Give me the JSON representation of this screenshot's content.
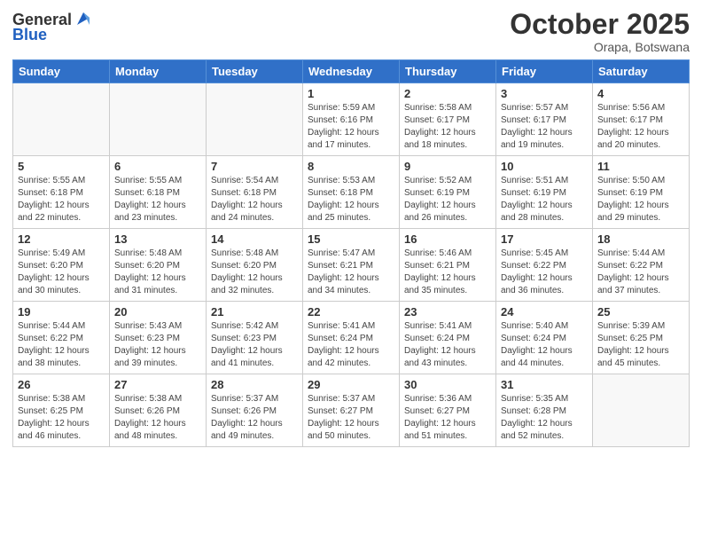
{
  "header": {
    "logo_general": "General",
    "logo_blue": "Blue",
    "month_title": "October 2025",
    "location": "Orapa, Botswana"
  },
  "days_of_week": [
    "Sunday",
    "Monday",
    "Tuesday",
    "Wednesday",
    "Thursday",
    "Friday",
    "Saturday"
  ],
  "weeks": [
    [
      {
        "day": "",
        "info": ""
      },
      {
        "day": "",
        "info": ""
      },
      {
        "day": "",
        "info": ""
      },
      {
        "day": "1",
        "info": "Sunrise: 5:59 AM\nSunset: 6:16 PM\nDaylight: 12 hours\nand 17 minutes."
      },
      {
        "day": "2",
        "info": "Sunrise: 5:58 AM\nSunset: 6:17 PM\nDaylight: 12 hours\nand 18 minutes."
      },
      {
        "day": "3",
        "info": "Sunrise: 5:57 AM\nSunset: 6:17 PM\nDaylight: 12 hours\nand 19 minutes."
      },
      {
        "day": "4",
        "info": "Sunrise: 5:56 AM\nSunset: 6:17 PM\nDaylight: 12 hours\nand 20 minutes."
      }
    ],
    [
      {
        "day": "5",
        "info": "Sunrise: 5:55 AM\nSunset: 6:18 PM\nDaylight: 12 hours\nand 22 minutes."
      },
      {
        "day": "6",
        "info": "Sunrise: 5:55 AM\nSunset: 6:18 PM\nDaylight: 12 hours\nand 23 minutes."
      },
      {
        "day": "7",
        "info": "Sunrise: 5:54 AM\nSunset: 6:18 PM\nDaylight: 12 hours\nand 24 minutes."
      },
      {
        "day": "8",
        "info": "Sunrise: 5:53 AM\nSunset: 6:18 PM\nDaylight: 12 hours\nand 25 minutes."
      },
      {
        "day": "9",
        "info": "Sunrise: 5:52 AM\nSunset: 6:19 PM\nDaylight: 12 hours\nand 26 minutes."
      },
      {
        "day": "10",
        "info": "Sunrise: 5:51 AM\nSunset: 6:19 PM\nDaylight: 12 hours\nand 28 minutes."
      },
      {
        "day": "11",
        "info": "Sunrise: 5:50 AM\nSunset: 6:19 PM\nDaylight: 12 hours\nand 29 minutes."
      }
    ],
    [
      {
        "day": "12",
        "info": "Sunrise: 5:49 AM\nSunset: 6:20 PM\nDaylight: 12 hours\nand 30 minutes."
      },
      {
        "day": "13",
        "info": "Sunrise: 5:48 AM\nSunset: 6:20 PM\nDaylight: 12 hours\nand 31 minutes."
      },
      {
        "day": "14",
        "info": "Sunrise: 5:48 AM\nSunset: 6:20 PM\nDaylight: 12 hours\nand 32 minutes."
      },
      {
        "day": "15",
        "info": "Sunrise: 5:47 AM\nSunset: 6:21 PM\nDaylight: 12 hours\nand 34 minutes."
      },
      {
        "day": "16",
        "info": "Sunrise: 5:46 AM\nSunset: 6:21 PM\nDaylight: 12 hours\nand 35 minutes."
      },
      {
        "day": "17",
        "info": "Sunrise: 5:45 AM\nSunset: 6:22 PM\nDaylight: 12 hours\nand 36 minutes."
      },
      {
        "day": "18",
        "info": "Sunrise: 5:44 AM\nSunset: 6:22 PM\nDaylight: 12 hours\nand 37 minutes."
      }
    ],
    [
      {
        "day": "19",
        "info": "Sunrise: 5:44 AM\nSunset: 6:22 PM\nDaylight: 12 hours\nand 38 minutes."
      },
      {
        "day": "20",
        "info": "Sunrise: 5:43 AM\nSunset: 6:23 PM\nDaylight: 12 hours\nand 39 minutes."
      },
      {
        "day": "21",
        "info": "Sunrise: 5:42 AM\nSunset: 6:23 PM\nDaylight: 12 hours\nand 41 minutes."
      },
      {
        "day": "22",
        "info": "Sunrise: 5:41 AM\nSunset: 6:24 PM\nDaylight: 12 hours\nand 42 minutes."
      },
      {
        "day": "23",
        "info": "Sunrise: 5:41 AM\nSunset: 6:24 PM\nDaylight: 12 hours\nand 43 minutes."
      },
      {
        "day": "24",
        "info": "Sunrise: 5:40 AM\nSunset: 6:24 PM\nDaylight: 12 hours\nand 44 minutes."
      },
      {
        "day": "25",
        "info": "Sunrise: 5:39 AM\nSunset: 6:25 PM\nDaylight: 12 hours\nand 45 minutes."
      }
    ],
    [
      {
        "day": "26",
        "info": "Sunrise: 5:38 AM\nSunset: 6:25 PM\nDaylight: 12 hours\nand 46 minutes."
      },
      {
        "day": "27",
        "info": "Sunrise: 5:38 AM\nSunset: 6:26 PM\nDaylight: 12 hours\nand 48 minutes."
      },
      {
        "day": "28",
        "info": "Sunrise: 5:37 AM\nSunset: 6:26 PM\nDaylight: 12 hours\nand 49 minutes."
      },
      {
        "day": "29",
        "info": "Sunrise: 5:37 AM\nSunset: 6:27 PM\nDaylight: 12 hours\nand 50 minutes."
      },
      {
        "day": "30",
        "info": "Sunrise: 5:36 AM\nSunset: 6:27 PM\nDaylight: 12 hours\nand 51 minutes."
      },
      {
        "day": "31",
        "info": "Sunrise: 5:35 AM\nSunset: 6:28 PM\nDaylight: 12 hours\nand 52 minutes."
      },
      {
        "day": "",
        "info": ""
      }
    ]
  ]
}
